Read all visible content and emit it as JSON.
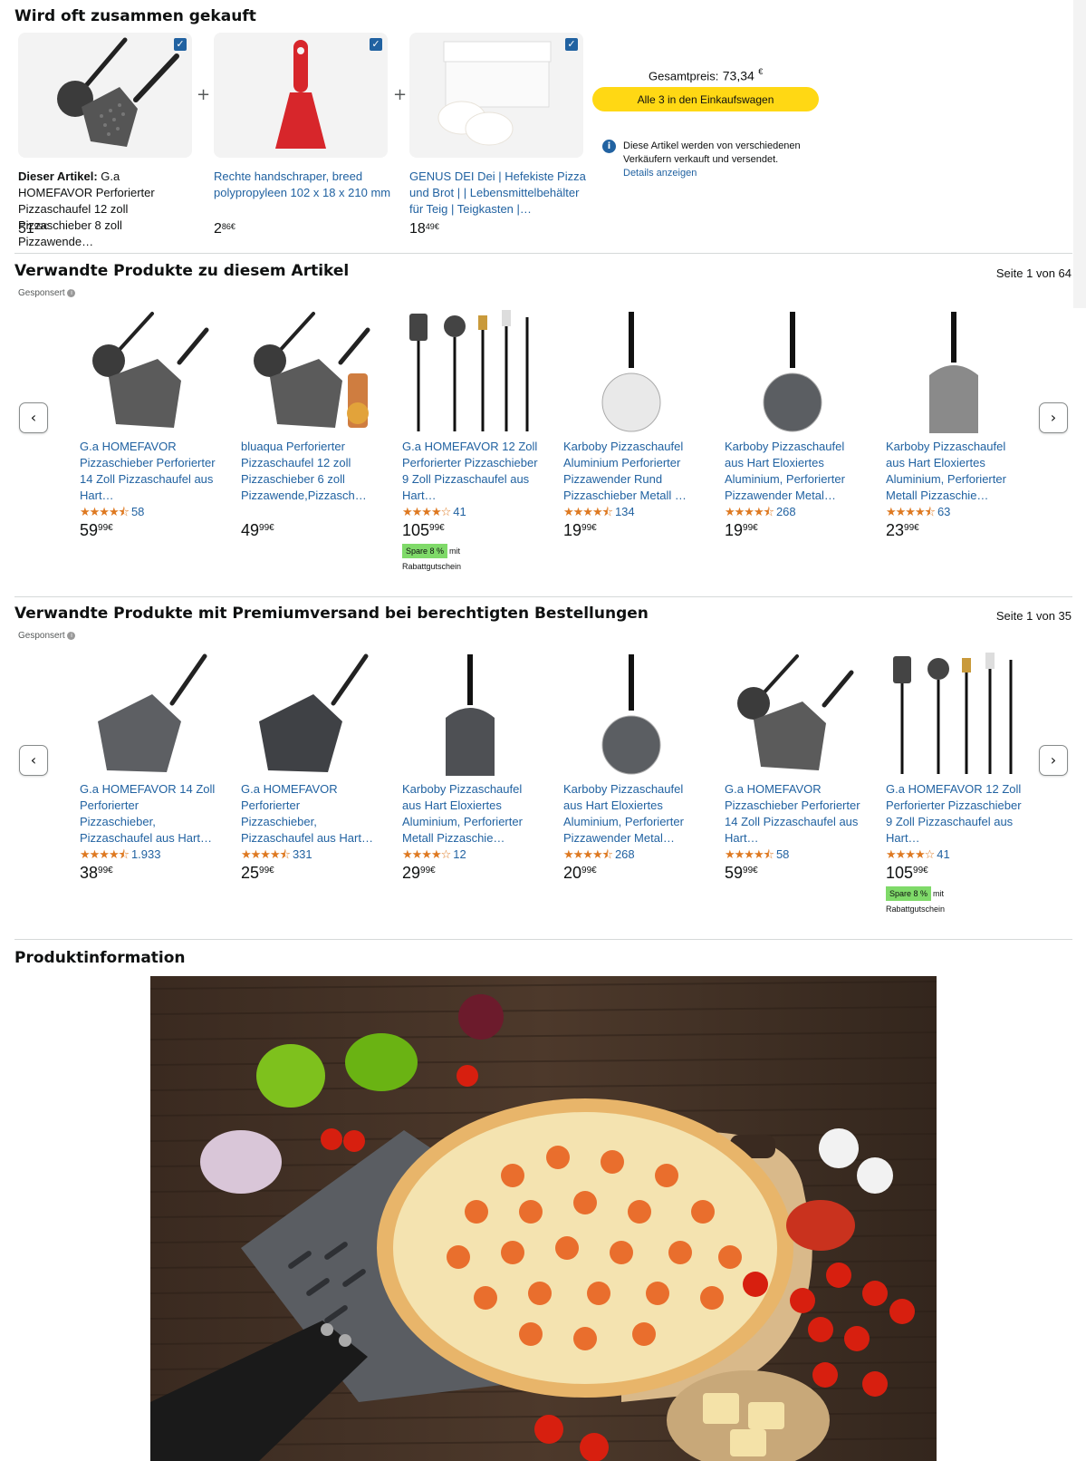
{
  "fbt": {
    "title": "Wird oft zusammen gekauft",
    "items": [
      {
        "prefix": "Dieser Artikel:",
        "title": "G.a HOMEFAVOR Perforierter Pizzaschaufel 12 zoll Pizzaschieber 8 zoll Pizzawende…",
        "price_whole": "51",
        "price_frac": "99",
        "currency": "€",
        "checked": true
      },
      {
        "title": "Rechte handschraper, breed polypropyleen 102 x 18 x 210 mm",
        "price_whole": "2",
        "price_frac": "86",
        "currency": "€",
        "checked": true
      },
      {
        "title": "GENUS DEI Dei | Hefekiste Pizza und Brot | | Lebensmittelbehälter für Teig | Teigkasten |…",
        "price_whole": "18",
        "price_frac": "49",
        "currency": "€",
        "checked": true
      }
    ],
    "total_label": "Gesamtpreis:",
    "total_value": "73,34",
    "total_currency": "€",
    "cart_button": "Alle 3 in den Einkaufswagen",
    "info_text": "Diese Artikel werden von verschiedenen Verkäufern verkauft und versendet.",
    "info_link": "Details anzeigen"
  },
  "related1": {
    "title": "Verwandte Produkte zu diesem Artikel",
    "pager": "Seite 1 von 64",
    "sponsored": "Gesponsert",
    "items": [
      {
        "title": "G.a HOMEFAVOR Pizzaschieber Perforierter 14 Zoll Pizzaschaufel aus Hart…",
        "stars": "★★★★⯪",
        "rating": 4.5,
        "reviews": "58",
        "pw": "59",
        "pf": "99",
        "cur": "€"
      },
      {
        "title": "bluaqua Perforierter Pizzaschaufel 12 zoll Pizzaschieber 6 zoll Pizzawende,Pizzasch…",
        "stars": "",
        "reviews": "",
        "pw": "49",
        "pf": "99",
        "cur": "€"
      },
      {
        "title": "G.a HOMEFAVOR 12 Zoll Perforierter Pizzaschieber 9 Zoll Pizzaschaufel aus Hart…",
        "stars": "★★★★☆",
        "rating": 4.0,
        "reviews": "41",
        "pw": "105",
        "pf": "99",
        "cur": "€",
        "badge": "Spare 8 %",
        "badge_mit": "mit",
        "badge_coupon": "Rabattgutschein"
      },
      {
        "title": "Karboby Pizzaschaufel Aluminium Perforierter Pizzawender Rund Pizzaschieber Metall …",
        "stars": "★★★★⯪",
        "rating": 4.5,
        "reviews": "134",
        "pw": "19",
        "pf": "99",
        "cur": "€"
      },
      {
        "title": "Karboby Pizzaschaufel aus Hart Eloxiertes Aluminium, Perforierter Pizzawender Metal…",
        "stars": "★★★★⯪",
        "rating": 4.5,
        "reviews": "268",
        "pw": "19",
        "pf": "99",
        "cur": "€"
      },
      {
        "title": "Karboby Pizzaschaufel aus Hart Eloxiertes Aluminium, Perforierter Metall Pizzaschie…",
        "stars": "★★★★⯪",
        "rating": 4.5,
        "reviews": "63",
        "pw": "23",
        "pf": "99",
        "cur": "€"
      }
    ]
  },
  "related2": {
    "title": "Verwandte Produkte mit Premiumversand bei berechtigten Bestellungen",
    "pager": "Seite 1 von 35",
    "sponsored": "Gesponsert",
    "items": [
      {
        "title": "G.a HOMEFAVOR 14 Zoll Perforierter Pizzaschieber, Pizzaschaufel aus Hart…",
        "stars": "★★★★⯪",
        "rating": 4.5,
        "reviews": "1.933",
        "pw": "38",
        "pf": "99",
        "cur": "€"
      },
      {
        "title": "G.a HOMEFAVOR Perforierter Pizzaschieber, Pizzaschaufel aus Hart…",
        "stars": "★★★★⯪",
        "rating": 4.5,
        "reviews": "331",
        "pw": "25",
        "pf": "99",
        "cur": "€"
      },
      {
        "title": "Karboby Pizzaschaufel aus Hart Eloxiertes Aluminium, Perforierter Metall Pizzaschie…",
        "stars": "★★★★☆",
        "rating": 4.0,
        "reviews": "12",
        "pw": "29",
        "pf": "99",
        "cur": "€"
      },
      {
        "title": "Karboby Pizzaschaufel aus Hart Eloxiertes Aluminium, Perforierter Pizzawender Metal…",
        "stars": "★★★★⯪",
        "rating": 4.5,
        "reviews": "268",
        "pw": "20",
        "pf": "99",
        "cur": "€"
      },
      {
        "title": "G.a HOMEFAVOR Pizzaschieber Perforierter 14 Zoll Pizzaschaufel aus Hart…",
        "stars": "★★★★⯪",
        "rating": 4.5,
        "reviews": "58",
        "pw": "59",
        "pf": "99",
        "cur": "€"
      },
      {
        "title": "G.a HOMEFAVOR 12 Zoll Perforierter Pizzaschieber 9 Zoll Pizzaschaufel aus Hart…",
        "stars": "★★★★☆",
        "rating": 4.0,
        "reviews": "41",
        "pw": "105",
        "pf": "99",
        "cur": "€",
        "badge": "Spare 8 %",
        "badge_mit": "mit",
        "badge_coupon": "Rabattgutschein"
      }
    ]
  },
  "product_info": {
    "title": "Produktinformation"
  },
  "colors": {
    "link": "#2162a1",
    "button": "#ffd814",
    "star": "#de7921",
    "badge": "#7fda69"
  },
  "icons": {
    "check": "✓",
    "prev": "‹",
    "next": "›",
    "plus": "+"
  }
}
